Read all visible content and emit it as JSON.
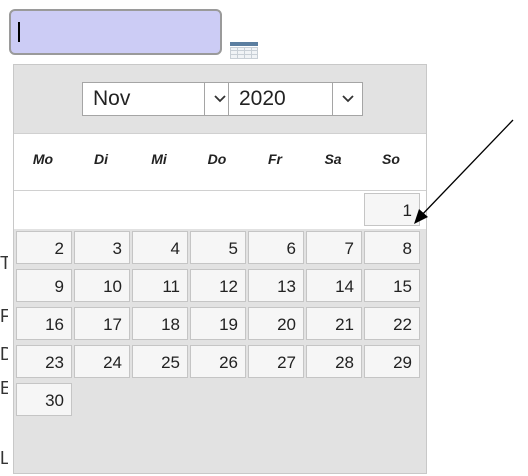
{
  "date_input": {
    "value": ""
  },
  "calendar": {
    "month": "Nov",
    "year": "2020",
    "weekdays": [
      "Mo",
      "Di",
      "Mi",
      "Do",
      "Fr",
      "Sa",
      "So"
    ],
    "weeks": [
      [
        null,
        null,
        null,
        null,
        null,
        null,
        "1"
      ],
      [
        "2",
        "3",
        "4",
        "5",
        "6",
        "7",
        "8"
      ],
      [
        "9",
        "10",
        "11",
        "12",
        "13",
        "14",
        "15"
      ],
      [
        "16",
        "17",
        "18",
        "19",
        "20",
        "21",
        "22"
      ],
      [
        "23",
        "24",
        "25",
        "26",
        "27",
        "28",
        "29"
      ],
      [
        "30",
        null,
        null,
        null,
        null,
        null,
        null
      ]
    ]
  },
  "background_fragments": [
    "T",
    "F",
    "D",
    "E",
    "L"
  ],
  "icons": {
    "calendar_button": "calendar-grid-icon",
    "dropdown": "chevron-down-icon",
    "annotation": "arrow-icon"
  },
  "colors": {
    "input_bg": "#ccccf5",
    "popup_bg": "#e2e2e2",
    "day_bg": "#f6f6f6"
  }
}
